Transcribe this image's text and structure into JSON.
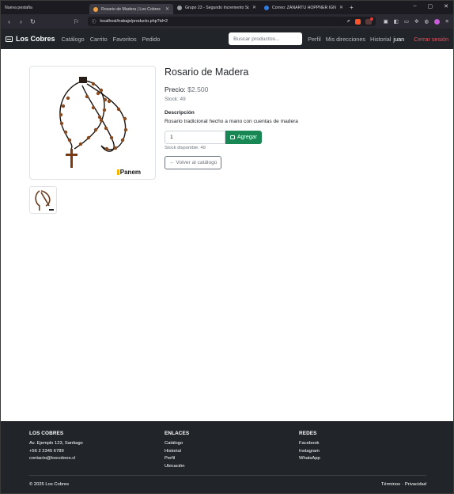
{
  "browser": {
    "tabs": [
      {
        "title": "Nueva pestaña",
        "favicon_color": ""
      },
      {
        "title": "Rosario de Madera | Los Cobres",
        "favicon_color": "#f0a040",
        "active": true
      },
      {
        "title": "Grupo 23 - Segundo Incremento Scr",
        "favicon_color": "#9aa0a6"
      },
      {
        "title": "Correo: ZAÑARTU HOPPNER IGNACI",
        "favicon_color": "#2f7de1"
      }
    ],
    "url": "localhost/trabajo/producto.php?id=2"
  },
  "site": {
    "brand": "Los Cobres",
    "nav_links": [
      "Catálogo",
      "Carrito",
      "Favoritos",
      "Pedido"
    ],
    "search_placeholder": "Buscar productos...",
    "right_links": [
      "Perfil",
      "Mis direcciones",
      "Historial"
    ],
    "user": "juan",
    "logout": "Cerrar sesión"
  },
  "product": {
    "name": "Rosario de Madera",
    "price_label": "Precio:",
    "price": "$2.500",
    "stock": "Stock: 49",
    "description_heading": "Descripción",
    "description": "Rosario tradicional hecho a mano con cuentas de madera",
    "quantity": "1",
    "add_label": "Agregar",
    "available": "Stock disponible: 49",
    "back_label": "← Volver al catálogo",
    "image_brand": "Panem"
  },
  "footer": {
    "col1": {
      "title": "LOS COBRES",
      "lines": [
        "Av. Ejemplo 123, Santiago",
        "+56 2 2345 6789",
        "contacto@loscobres.cl"
      ]
    },
    "col2": {
      "title": "ENLACES",
      "lines": [
        "Catálogo",
        "Historial",
        "Perfil",
        "Ubicación"
      ]
    },
    "col3": {
      "title": "REDES",
      "lines": [
        "Facebook",
        "Instagram",
        "WhatsApp"
      ]
    },
    "copyright": "© 2025 Los Cobres",
    "terms": "Términos",
    "sep": "·",
    "privacy": "Privacidad"
  },
  "colors": {
    "accent_green": "#198754",
    "nav_dark": "#212529",
    "logout_red": "#e2545f"
  }
}
